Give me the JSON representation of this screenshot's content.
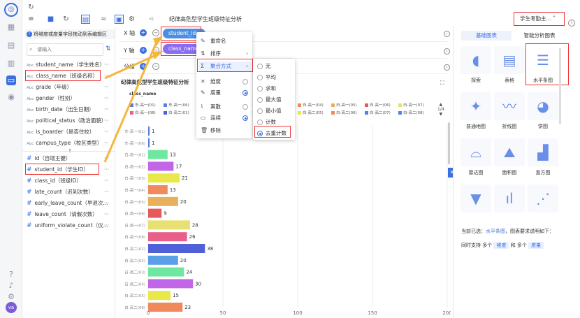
{
  "toolbar": {
    "title": "纪律高危型学生班级特征分析",
    "dataset": "学生考勤主..."
  },
  "hint": "将维度或度量字段拖动到表编辑区",
  "search": {
    "placeholder": "请输入"
  },
  "dimensions": [
    {
      "name": "student_name（学生姓名）"
    },
    {
      "name": "class_name（班级名称）"
    },
    {
      "name": "grade（年级）"
    },
    {
      "name": "gender（性别）"
    },
    {
      "name": "birth_date（出生日期）"
    },
    {
      "name": "political_status（政治面貌）"
    },
    {
      "name": "is_boarder（是否住校）"
    },
    {
      "name": "campus_type（校区类型）"
    }
  ],
  "dim_tag": "Abc",
  "measures": [
    {
      "name": "id（自增主键）"
    },
    {
      "name": "student_id（学生ID）"
    },
    {
      "name": "class_id（班级ID）"
    },
    {
      "name": "late_count（迟到次数）"
    },
    {
      "name": "early_leave_count（早退次..."
    },
    {
      "name": "leave_count（请假次数）"
    },
    {
      "name": "uniform_violate_count（仪..."
    }
  ],
  "shelves": {
    "x": "X 轴",
    "y": "Y 轴",
    "group": "分组",
    "x_field": "student_id",
    "y_field": "class_name"
  },
  "menu": [
    {
      "label": "重命名",
      "icon": "✎"
    },
    {
      "label": "排序",
      "icon": "⇅"
    },
    {
      "label": "聚合方式",
      "icon": "Σ"
    },
    {
      "label": "维度",
      "icon": "✕"
    },
    {
      "label": "度量",
      "icon": "✎"
    },
    {
      "label": "离散",
      "icon": "⌇"
    },
    {
      "label": "连续",
      "icon": "▭"
    },
    {
      "label": "移除",
      "icon": "🗑"
    }
  ],
  "agg": [
    "无",
    "平均",
    "求和",
    "最大值",
    "最小值",
    "计数",
    "去重计数"
  ],
  "agg_selected": 6,
  "chart_title": "纪律高危型学生班级特征分析",
  "legend_title": "class_name",
  "legend_page": "1/4",
  "chart_data": {
    "type": "bar",
    "orientation": "horizontal",
    "categories": [
      "东-高一(01)",
      "东-高一(06)",
      "白-高一(01)",
      "白-高一(02)",
      "白-高一(03)",
      "白-高一(04)",
      "白-高一(05)",
      "白-高一(06)",
      "白-高一(07)",
      "白-高一(08)",
      "白-高二(01)",
      "白-高二(02)",
      "白-高二(03)",
      "白-高二(04)",
      "白-高二(05)",
      "白-高二(06)"
    ],
    "values": [
      1,
      1,
      13,
      17,
      21,
      13,
      20,
      9,
      28,
      26,
      38,
      20,
      24,
      30,
      15,
      23
    ],
    "colors": [
      "#5b7ee5",
      "#5b7ee5",
      "#6ee7a0",
      "#c266e8",
      "#e8e84a",
      "#f08a5d",
      "#e8b05a",
      "#e85a5a",
      "#e8e070",
      "#e8608a",
      "#5060d8",
      "#5aa0e8",
      "#6ee7a0",
      "#c266e8",
      "#e8e84a",
      "#f08a5d"
    ],
    "xlim": [
      0,
      200
    ],
    "xticks": [
      0,
      50,
      100,
      150,
      200
    ],
    "legend": [
      "东-高一(01)",
      "东-高一(06)",
      "白-高一(01)",
      "白-高一(02)",
      "白-高一(03)",
      "白-高一(04)",
      "白-高一(05)",
      "白-高一(06)",
      "白-高一(07)",
      "白-高一(08)",
      "白-高二(01)",
      "白-高二(02)",
      "白-高二(03)",
      "白-高二(04)",
      "白-高二(05)",
      "白-高二(06)",
      "白-高二(07)",
      "白-高二(08)"
    ]
  },
  "right": {
    "tabs": [
      "基础图表",
      "智能分析图表"
    ],
    "charts": [
      "探索",
      "表格",
      "水平条图",
      "普通地图",
      "折线图",
      "饼图",
      "雷达图",
      "面积图",
      "直方图",
      "",
      "",
      ""
    ],
    "desc_prefix": "当前已选：",
    "desc_chart": "水平条图",
    "desc_suffix": "，图表要求说明如下：",
    "req_1": "同时支持 多个",
    "req_dim": "维度",
    "req_2": "和 多个",
    "req_mea": "度量"
  }
}
